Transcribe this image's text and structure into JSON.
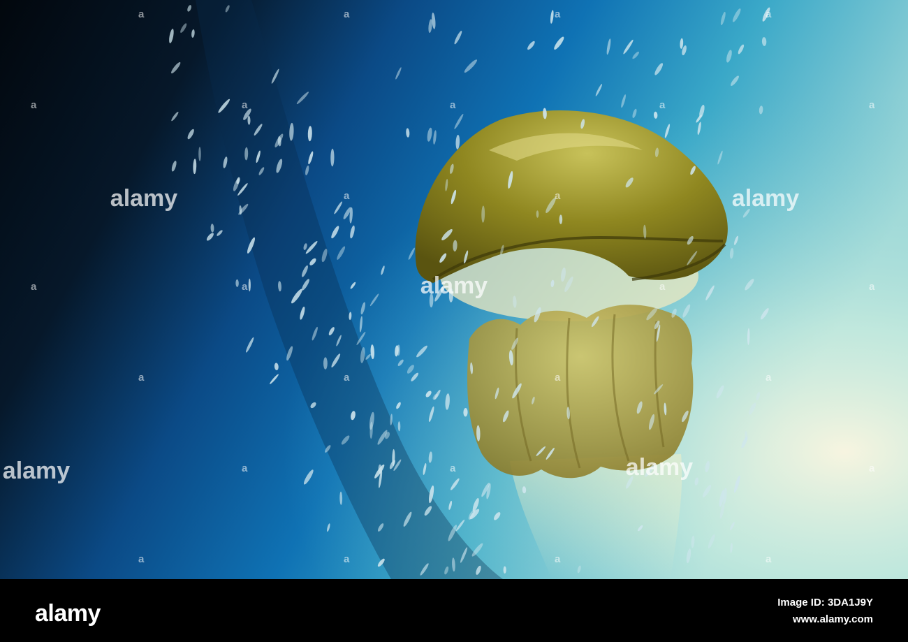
{
  "photo": {
    "subject_icon": "jellyfish-icon",
    "secondary_icon": "fish-school-icon",
    "colors": {
      "deep_water": "#04121e",
      "mid_water": "#0c5ea6",
      "bright_water": "#bfece2",
      "bell": "#8f8720",
      "bell_highlight": "#c8c25a",
      "oral_arms": "#a89a3c",
      "fish": "#cfe6ee"
    }
  },
  "watermark": {
    "text": "alamy",
    "tag": "a"
  },
  "footer": {
    "logo": "alamy",
    "image_id": "Image ID: 3DA1J9Y",
    "site": "www.alamy.com"
  }
}
